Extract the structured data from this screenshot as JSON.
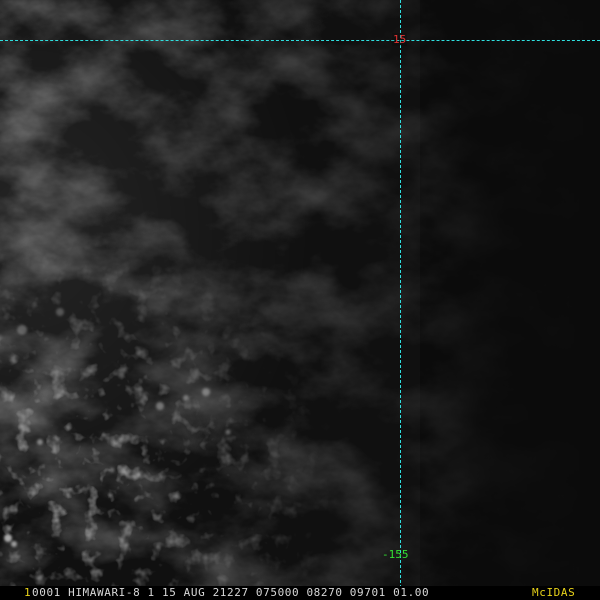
{
  "overlay": {
    "latitude_label": "15",
    "longitude_label": "-155"
  },
  "status_bar": {
    "frame_number": "1",
    "info": "0001 HIMAWARI-8  1 15 AUG 21227 075000 08270 09701 01.00",
    "brand": "McIDAS"
  },
  "colors": {
    "grid_line": "#2fe0e0",
    "latitude_label": "#e03030",
    "longitude_label": "#33e033",
    "frame_number": "#e8d21a",
    "brand": "#e8d21a",
    "info_text": "#d8d8d8"
  }
}
